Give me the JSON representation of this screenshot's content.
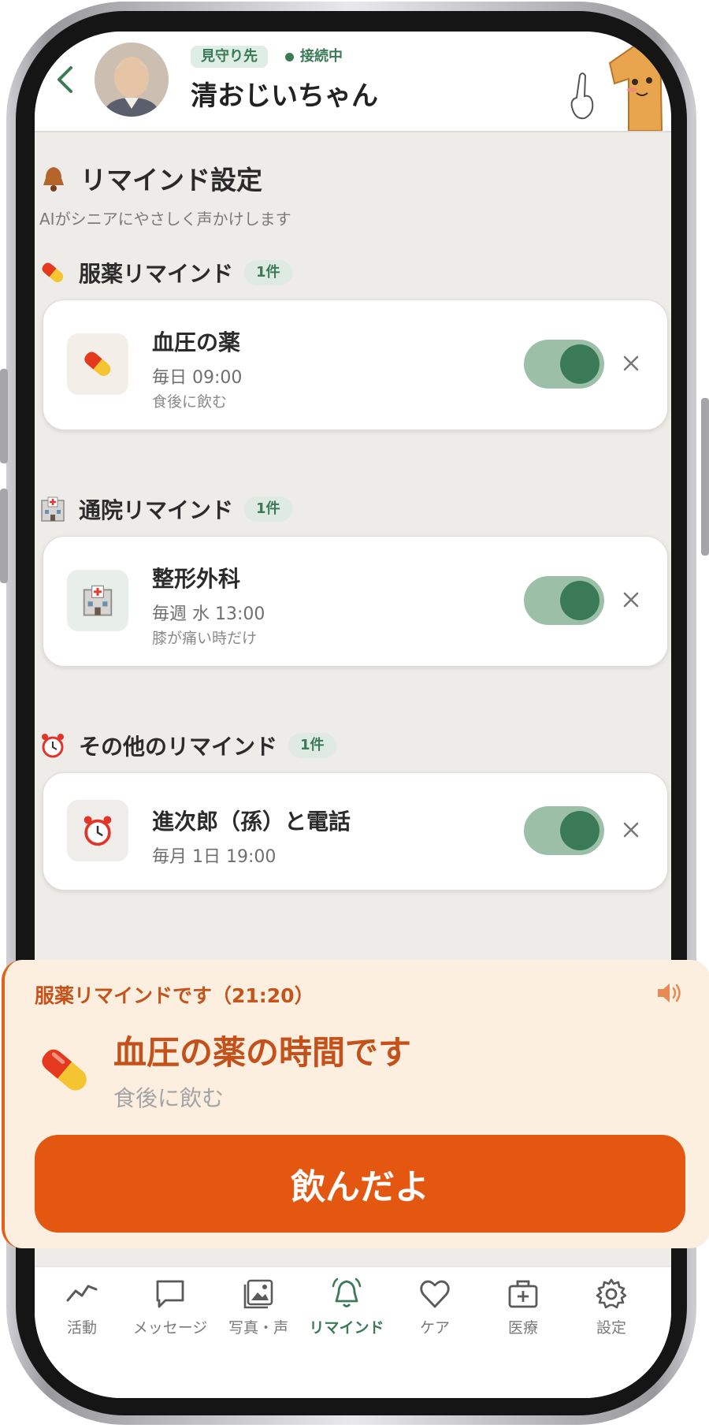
{
  "header": {
    "watch_label": "見守り先",
    "status_label": "接続中",
    "name": "清おじいちゃん"
  },
  "page": {
    "title": "リマインド設定",
    "subtitle": "AIがシニアにやさしく声かけします"
  },
  "sections": [
    {
      "title": "服薬リマインド",
      "count": "1件",
      "icon": "pill-icon",
      "items": [
        {
          "title": "血圧の薬",
          "schedule": "毎日 09:00",
          "note": "食後に飲む",
          "enabled": true
        }
      ]
    },
    {
      "title": "通院リマインド",
      "count": "1件",
      "icon": "hospital-icon",
      "items": [
        {
          "title": "整形外科",
          "schedule": "毎週 水 13:00",
          "note": "膝が痛い時だけ",
          "enabled": true
        }
      ]
    },
    {
      "title": "その他のリマインド",
      "count": "1件",
      "icon": "alarm-clock-icon",
      "items": [
        {
          "title": "進次郎（孫）と電話",
          "schedule": "毎月 1日 19:00",
          "enabled": true
        }
      ]
    }
  ],
  "alert": {
    "heading": "服薬リマインドです（21:20）",
    "title": "血圧の薬の時間です",
    "note": "食後に飲む",
    "button_label": "飲んだよ"
  },
  "nav": {
    "items": [
      {
        "label": "活動",
        "icon": "activity-chart-icon"
      },
      {
        "label": "メッセージ",
        "icon": "message-icon"
      },
      {
        "label": "写真・声",
        "icon": "photo-icon"
      },
      {
        "label": "リマインド",
        "icon": "bell-icon",
        "active": true
      },
      {
        "label": "ケア",
        "icon": "heart-icon"
      },
      {
        "label": "医療",
        "icon": "medical-bag-icon"
      },
      {
        "label": "設定",
        "icon": "gear-icon"
      }
    ]
  },
  "colors": {
    "brand_green": "#3b7a56",
    "toggle_track": "#9cbfa8",
    "alert_orange": "#e35711",
    "alert_bg": "#fcefe0"
  }
}
